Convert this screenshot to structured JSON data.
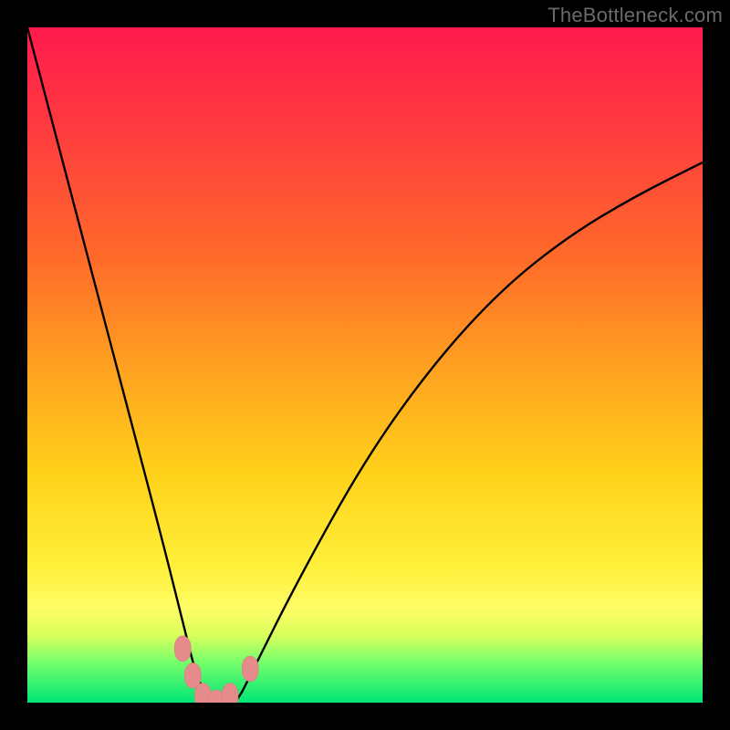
{
  "watermark": {
    "text": "TheBottleneck.com"
  },
  "chart_data": {
    "type": "line",
    "title": "",
    "xlabel": "",
    "ylabel": "",
    "xlim": [
      0,
      100
    ],
    "ylim": [
      0,
      100
    ],
    "grid": false,
    "legend": false,
    "series": [
      {
        "name": "bottleneck-curve",
        "x": [
          0,
          5,
          10,
          15,
          20,
          23,
          25,
          27,
          29,
          31,
          33,
          40,
          50,
          60,
          70,
          80,
          90,
          100
        ],
        "y": [
          100,
          81,
          62,
          43,
          24,
          12,
          4,
          0,
          0,
          0,
          4,
          18,
          36,
          50,
          61,
          69,
          75,
          80
        ]
      }
    ],
    "markers": [
      {
        "x": 23,
        "y": 8
      },
      {
        "x": 24.5,
        "y": 4
      },
      {
        "x": 26,
        "y": 1
      },
      {
        "x": 28,
        "y": 0
      },
      {
        "x": 30,
        "y": 1
      },
      {
        "x": 33,
        "y": 5
      }
    ],
    "colors": {
      "curve": "#000000",
      "marker": "#e58b8b",
      "gradient": [
        "#ff1a4d",
        "#ff6a2a",
        "#ffd11a",
        "#fffc66",
        "#00e676"
      ]
    }
  }
}
